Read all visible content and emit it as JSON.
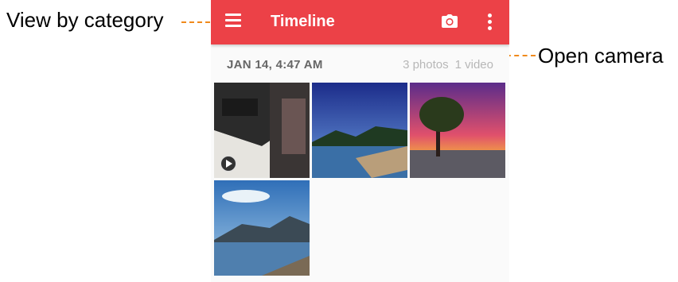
{
  "callouts": {
    "view_by_category": "View by category",
    "open_camera": "Open camera"
  },
  "appbar": {
    "title": "Timeline",
    "menu_icon": "menu-icon",
    "camera_icon": "camera-icon",
    "more_icon": "more-vert-icon",
    "color": "#ec4147"
  },
  "section": {
    "date": "JAN 14, 4:47 AM",
    "photos_count": "3 photos",
    "videos_count": "1 video"
  },
  "thumbnails": [
    {
      "kind": "video",
      "subject": "office desk with computer and chair"
    },
    {
      "kind": "photo",
      "subject": "lake shore with mountains and blue sky"
    },
    {
      "kind": "photo",
      "subject": "lone tree at sunset with purple sky"
    },
    {
      "kind": "photo",
      "subject": "mountain lake with clouds and blue sky"
    }
  ],
  "colors": {
    "leader": "#f08a1c"
  }
}
